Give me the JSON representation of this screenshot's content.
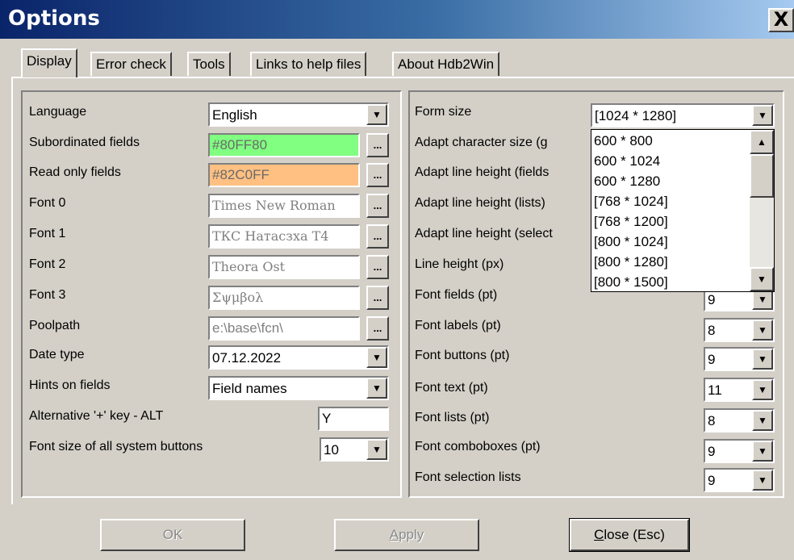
{
  "window": {
    "title": "Options",
    "close_label": "X"
  },
  "tabs": [
    {
      "label": "Display",
      "active": true
    },
    {
      "label": "Error check"
    },
    {
      "label": "Tools"
    },
    {
      "label": "Links to help files"
    },
    {
      "label": "About Hdb2Win"
    }
  ],
  "left": {
    "language": {
      "label": "Language",
      "value": "English"
    },
    "subordinated": {
      "label": "Subordinated fields",
      "value": "#80FF80",
      "color": "#80ff80",
      "button": "..."
    },
    "readonly": {
      "label": "Read only fields",
      "value": "#82C0FF",
      "color": "#ffc082",
      "button": "..."
    },
    "font0": {
      "label": "Font 0",
      "value": "Times New Roman",
      "button": "..."
    },
    "font1": {
      "label": "Font 1",
      "value": "ТКС Натасзха Т4",
      "button": "..."
    },
    "font2": {
      "label": "Font 2",
      "value": "Theora Ost",
      "button": "..."
    },
    "font3": {
      "label": "Font 3",
      "value": "Σψμβολ",
      "button": "..."
    },
    "poolpath": {
      "label": "Poolpath",
      "value": "e:\\base\\fcn\\",
      "button": "..."
    },
    "datetype": {
      "label": "Date type",
      "value": "07.12.2022"
    },
    "hints": {
      "label": "Hints on fields",
      "value": "Field names"
    },
    "altkey": {
      "label": "Alternative '+' key - ALT",
      "value": "Y"
    },
    "sysbtn": {
      "label": "Font size of all system buttons",
      "value": "10"
    }
  },
  "right": {
    "formsize": {
      "label": "Form size",
      "value": "[1024 * 1280]"
    },
    "adapt_char": {
      "label": "Adapt character size (g"
    },
    "adapt_fields": {
      "label": "Adapt line height (fields"
    },
    "adapt_lists": {
      "label": "Adapt line height (lists)"
    },
    "adapt_select": {
      "label": "Adapt line height (select"
    },
    "line_height": {
      "label": "Line height (px)"
    },
    "font_fields": {
      "label": "Font fields (pt)",
      "value": "9"
    },
    "font_labels": {
      "label": "Font labels (pt)",
      "value": "8"
    },
    "font_buttons": {
      "label": "Font buttons (pt)",
      "value": "9"
    },
    "font_text": {
      "label": "Font text (pt)",
      "value": "11"
    },
    "font_lists": {
      "label": "Font lists (pt)",
      "value": "8"
    },
    "font_combo": {
      "label": "Font comboboxes (pt)",
      "value": "9"
    },
    "font_select": {
      "label": "Font selection lists",
      "value": "9"
    }
  },
  "dropdown": {
    "options": [
      "600 * 800",
      "600 * 1024",
      "600 * 1280",
      "[768 * 1024]",
      "[768 * 1200]",
      "[800 * 1024]",
      "[800 * 1280]",
      "[800 * 1500]"
    ]
  },
  "buttons": {
    "ok": "OK",
    "apply_key": "A",
    "apply_rest": "pply",
    "close_key": "C",
    "close_rest": "lose (Esc)"
  },
  "icons": {
    "arrow": "▼",
    "arrow_up": "▲"
  }
}
